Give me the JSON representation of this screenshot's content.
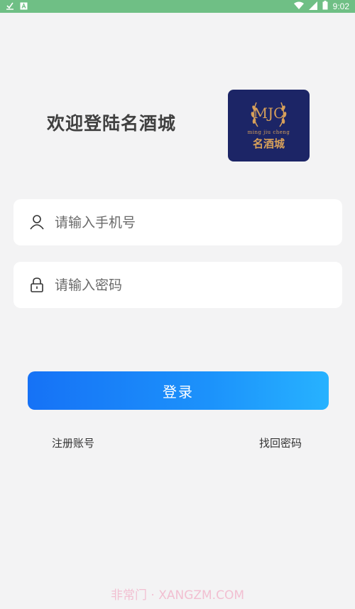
{
  "status_bar": {
    "time": "9:02",
    "icons": [
      "download-done-icon",
      "app-notification-icon",
      "wifi-icon",
      "signal-icon",
      "battery-icon"
    ]
  },
  "header": {
    "welcome_text": "欢迎登陆名酒城"
  },
  "logo": {
    "monogram": "MJC",
    "subtitle": "ming jiu cheng",
    "chinese_name": "名酒城",
    "background_color": "#1c2566",
    "accent_color": "#d7a05a"
  },
  "form": {
    "phone": {
      "placeholder": "请输入手机号",
      "value": "",
      "icon": "user-icon"
    },
    "password": {
      "placeholder": "请输入密码",
      "value": "",
      "icon": "lock-icon"
    },
    "login_label": "登录"
  },
  "links": {
    "register": "注册账号",
    "forgot_password": "找回密码"
  },
  "watermark": "非常门 · XANGZM.COM",
  "colors": {
    "status_bar": "#6fbf85",
    "button_start": "#1672f6",
    "button_end": "#27b2ff",
    "page_background": "#f3f3f4"
  }
}
